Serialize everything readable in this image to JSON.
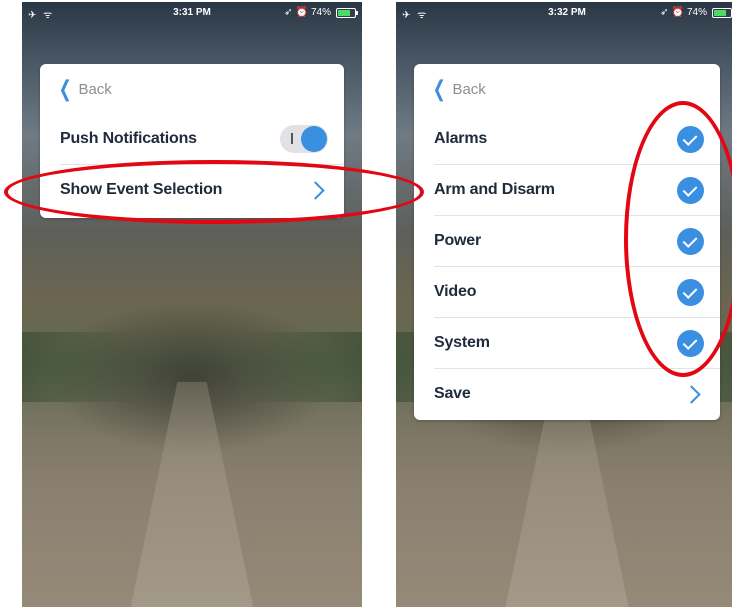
{
  "left_screen": {
    "status": {
      "time": "3:31 PM",
      "battery": "74%"
    },
    "back_label": "Back",
    "rows": [
      {
        "label": "Push Notifications"
      },
      {
        "label": "Show Event Selection"
      }
    ]
  },
  "right_screen": {
    "status": {
      "time": "3:32 PM",
      "battery": "74%"
    },
    "back_label": "Back",
    "rows": [
      {
        "label": "Alarms",
        "checked": true
      },
      {
        "label": "Arm and Disarm",
        "checked": true
      },
      {
        "label": "Power",
        "checked": true
      },
      {
        "label": "Video",
        "checked": true
      },
      {
        "label": "System",
        "checked": true
      },
      {
        "label": "Save"
      }
    ]
  },
  "colors": {
    "accent": "#3a8fe0",
    "annotation": "#e30613",
    "battery": "#4cd964"
  },
  "icons": [
    "airplane-icon",
    "wifi-icon",
    "location-arrow-icon",
    "alarm-icon",
    "battery-icon",
    "chevron-left-icon",
    "chevron-right-icon",
    "checkmark-icon"
  ]
}
